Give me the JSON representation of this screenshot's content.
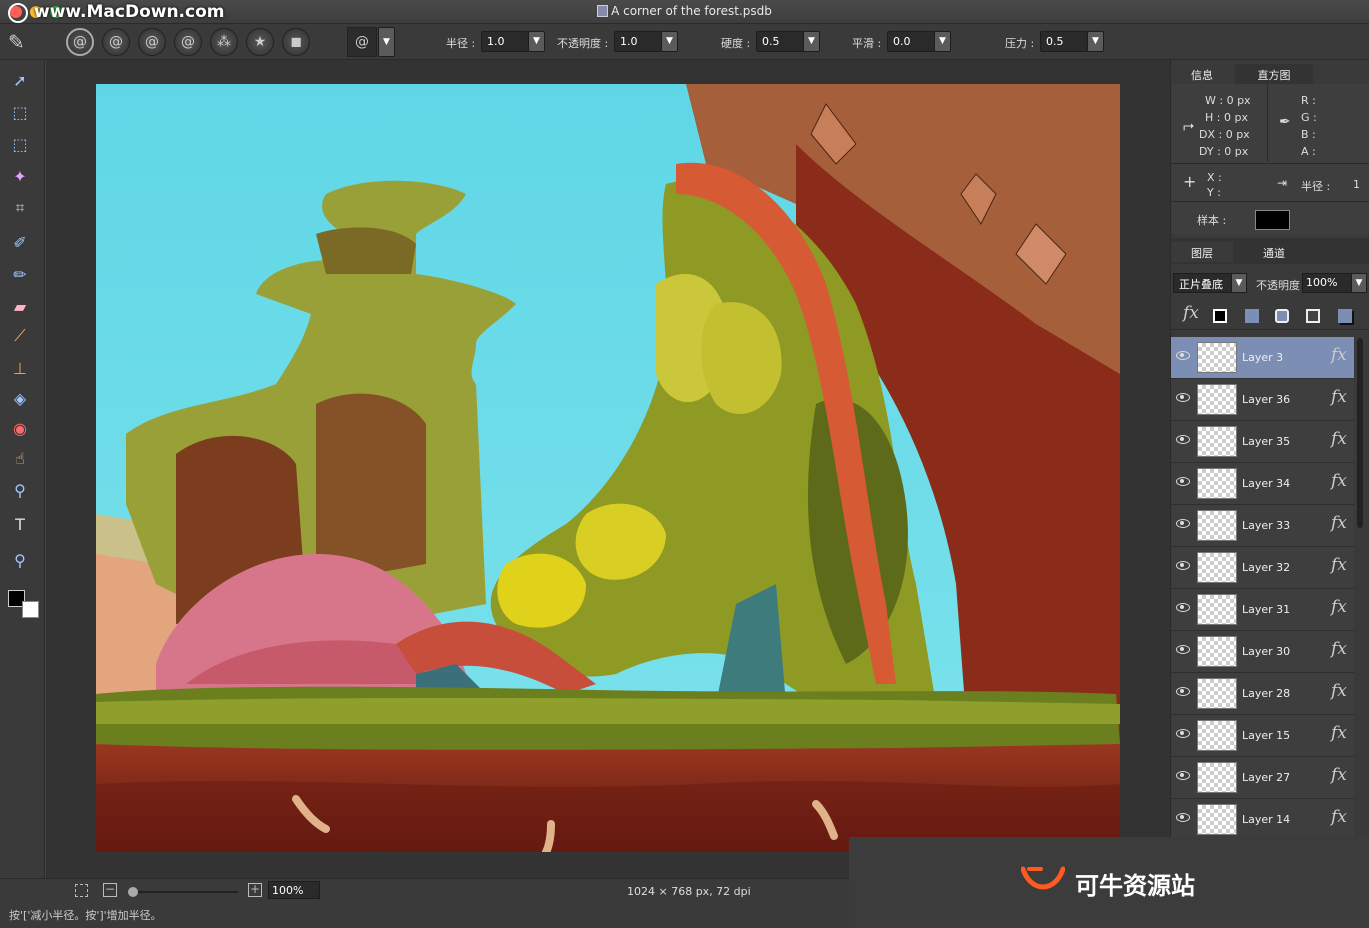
{
  "window": {
    "title": "A corner of the forest.psdb",
    "watermark": "www.MacDown.com"
  },
  "options_bar": {
    "brush_presets": [
      "brush-round-icon",
      "brush-soft-icon",
      "brush-hard-icon",
      "brush-texture-icon",
      "brush-splatter-icon",
      "brush-star-icon",
      "brush-block-icon"
    ],
    "radius_label": "半径 :",
    "radius_value": "1.0",
    "opacity_label": "不透明度 :",
    "opacity_value": "1.0",
    "hardness_label": "硬度 :",
    "hardness_value": "0.5",
    "smoothing_label": "平滑 :",
    "smoothing_value": "0.0",
    "pressure_label": "压力 :",
    "pressure_value": "0.5"
  },
  "tools": [
    "move-icon",
    "transform-icon",
    "marquee-icon",
    "magic-wand-icon",
    "crop-icon",
    "brush-icon",
    "pencil-icon",
    "eraser-icon",
    "eyedropper-icon",
    "stamp-icon",
    "bucket-icon",
    "red-eye-icon",
    "smudge-icon",
    "zoom-icon",
    "type-icon",
    "magnifier-icon"
  ],
  "colors": {
    "foreground": "#000000",
    "background": "#ffffff",
    "selected_layer": "#7d8eb4"
  },
  "info_panel": {
    "tab_info": "信息",
    "tab_histogram": "直方图",
    "w": "W :  0 px",
    "h": "H :  0 px",
    "dx": "DX :  0 px",
    "dy": "DY :  0 px",
    "r": "R :",
    "g": "G :",
    "b": "B :",
    "a": "A :",
    "x": "X :",
    "y": "Y :",
    "radius_label": "半径 :",
    "radius_value": "1",
    "sample_label": "样本 :"
  },
  "layers_panel": {
    "tab_layers": "图层",
    "tab_channels": "通道",
    "blend_mode": "正片叠底",
    "opacity_label": "不透明度",
    "opacity_value": "100%",
    "fx_label": "fx",
    "layers": [
      {
        "name": "Layer 3",
        "selected": true
      },
      {
        "name": "Layer 36",
        "selected": false
      },
      {
        "name": "Layer 35",
        "selected": false
      },
      {
        "name": "Layer 34",
        "selected": false
      },
      {
        "name": "Layer 33",
        "selected": false
      },
      {
        "name": "Layer 32",
        "selected": false
      },
      {
        "name": "Layer 31",
        "selected": false
      },
      {
        "name": "Layer 30",
        "selected": false
      },
      {
        "name": "Layer 28",
        "selected": false
      },
      {
        "name": "Layer 15",
        "selected": false
      },
      {
        "name": "Layer 27",
        "selected": false
      },
      {
        "name": "Layer 14",
        "selected": false
      }
    ]
  },
  "status": {
    "zoom": "100%",
    "doc_size": "1024 × 768 px, 72 dpi",
    "hint": "按'['减小半径。按']'增加半径。"
  },
  "branding": {
    "text": "可牛资源站"
  }
}
